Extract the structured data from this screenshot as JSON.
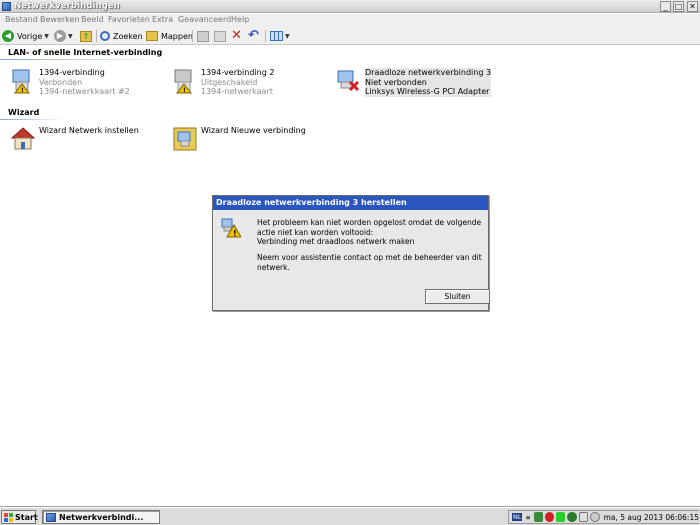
{
  "window": {
    "title": "Netwerkverbindingen"
  },
  "menu": [
    "Bestand",
    "Bewerken",
    "Beeld",
    "Favorieten",
    "Extra",
    "Geavanceerd",
    "Help"
  ],
  "toolbar": {
    "back": "Vorige",
    "search": "Zoeken",
    "folders": "Mappen"
  },
  "groups": {
    "lan": {
      "header": "LAN- of snelle Internet-verbinding",
      "items": [
        {
          "name": "1394-verbinding",
          "status": "Verbonden",
          "device": "1394-netwerkkaart #2"
        },
        {
          "name": "1394-verbinding 2",
          "status": "Uitgeschakeld",
          "device": "1394-netwerkaart"
        },
        {
          "name": "Draadloze netwerkverbinding 3",
          "status": "Niet verbonden",
          "device": "Linksys Wireless-G PCI Adapter"
        }
      ]
    },
    "wizard": {
      "header": "Wizard",
      "items": [
        {
          "name": "Wizard Netwerk instellen"
        },
        {
          "name": "Wizard Nieuwe verbinding"
        }
      ]
    }
  },
  "dialog": {
    "title": "Draadloze netwerkverbinding 3 herstellen",
    "line1": "Het probleem kan niet worden opgelost omdat de volgende actie niet kan worden voltooid:",
    "line2": "Verbinding met draadloos netwerk maken",
    "line3": "Neem voor assistentie contact op met de beheerder van dit netwerk.",
    "button": "Sluiten"
  },
  "taskbar": {
    "start": "Start",
    "task": "Netwerkverbindi...",
    "lang": "NL",
    "datetime": "ma, 5 aug 2013  06:06:15"
  },
  "colors": {
    "title_accent": "#2a56c0",
    "warning": "#f2c200",
    "error": "#d42020"
  }
}
